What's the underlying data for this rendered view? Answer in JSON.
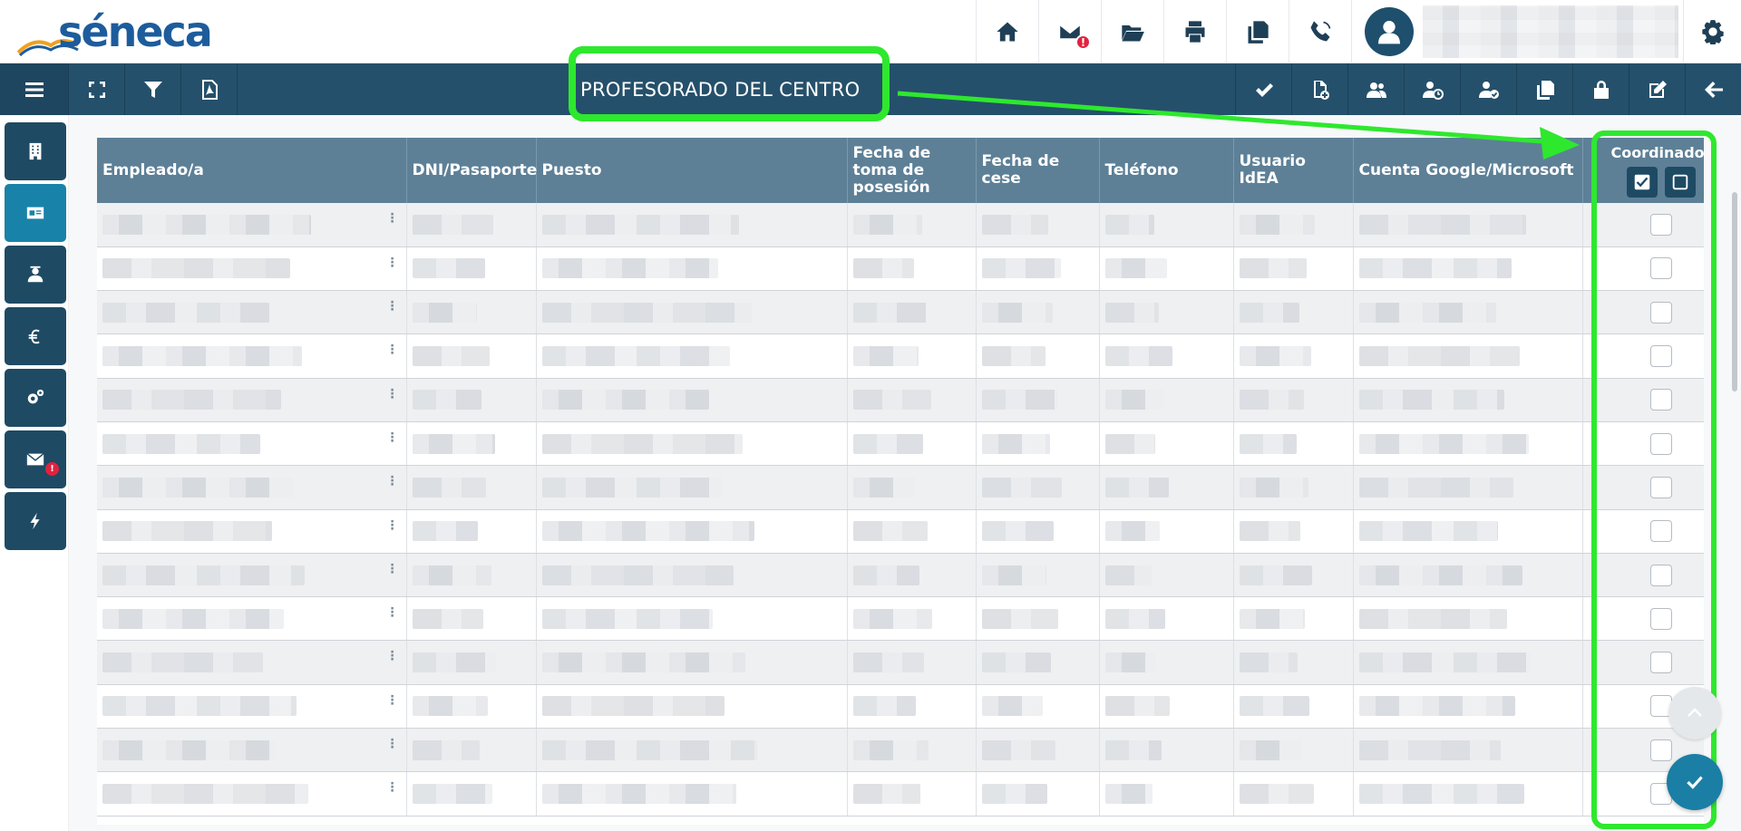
{
  "app": {
    "logo_text": "séneca",
    "page_title": "PROFESORADO DEL CENTRO"
  },
  "header_icons": [
    "home-icon",
    "mail-icon",
    "folder-open-icon",
    "printer-icon",
    "copy-icon",
    "phone-icon"
  ],
  "nav_left_icons": [
    "menu-icon",
    "expand-icon",
    "filter-icon",
    "pdf-icon"
  ],
  "nav_right_icons": [
    "check-icon",
    "new-document-icon",
    "users-icon",
    "user-clock-icon",
    "user-check-icon",
    "copy-icon",
    "lock-icon",
    "edit-icon",
    "arrow-left-icon"
  ],
  "rail_icons": [
    "building-icon",
    "id-card-icon",
    "teacher-icon",
    "euro-icon",
    "gears-icon",
    "mail-icon",
    "bolt-icon"
  ],
  "mail_alert": "!",
  "table": {
    "columns": {
      "empleado": "Empleado/a",
      "dni": "DNI/Pasaporte",
      "puesto": "Puesto",
      "fecha_toma": "Fecha de toma de posesión",
      "fecha_cese": "Fecha de cese",
      "telefono": "Teléfono",
      "usuario": "Usuario IdEA",
      "cuenta": "Cuenta Google/Microsoft",
      "coordinador": "Coordinador"
    },
    "coordinador_checked": [
      false,
      false,
      false,
      false,
      false,
      false,
      false,
      false,
      false,
      false,
      false,
      false,
      false,
      false
    ]
  },
  "colors": {
    "navbar": "#25506b",
    "table_header": "#5d8097",
    "accent": "#1982a8",
    "annotation": "#2ee82e",
    "alert": "#e1223f"
  }
}
